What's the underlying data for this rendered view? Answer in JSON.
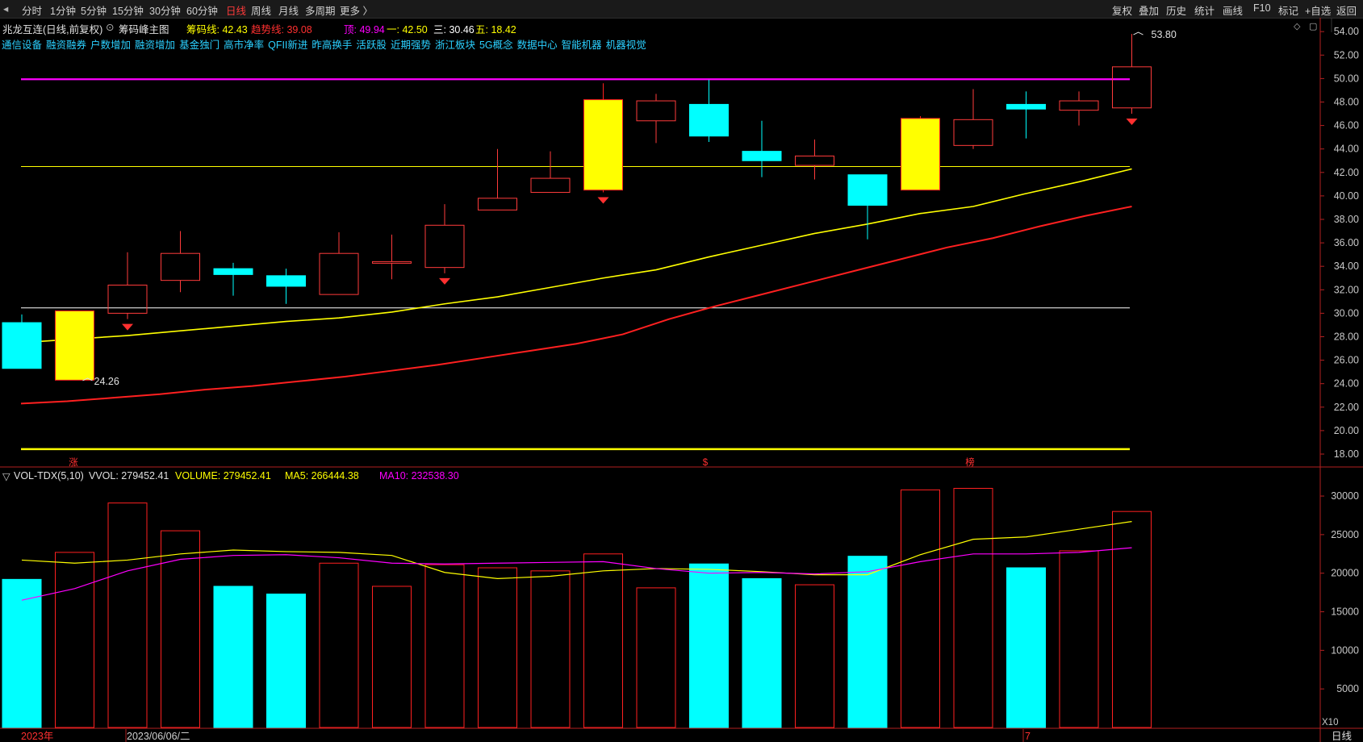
{
  "toolbar": {
    "periods": [
      "分时",
      "1分钟",
      "5分钟",
      "15分钟",
      "30分钟",
      "60分钟",
      "日线",
      "周线",
      "月线",
      "多周期",
      "更多 〉"
    ],
    "active_period": "日线",
    "right_buttons": [
      "复权",
      "叠加",
      "历史",
      "统计",
      "画线",
      "F10",
      "标记",
      "+自选",
      "返回"
    ]
  },
  "header": {
    "stock_title": "兆龙互连(日线,前复权)",
    "indicator_name": "筹码峰主图",
    "chip_line": "筹码线: 42.43",
    "trend_line": "趋势线: 39.08",
    "top_label": "顶: 49.94",
    "one_label": "一: 42.50",
    "three_label": "三: 30.46",
    "five_label": "五: 18.42",
    "window_icons": [
      "◇",
      "▢"
    ]
  },
  "tags": [
    "通信设备",
    "融资融券",
    "户数增加",
    "融资增加",
    "基金独门",
    "高市净率",
    "QFII新进",
    "昨高换手",
    "活跃股",
    "近期强势",
    "浙江板块",
    "5G概念",
    "数据中心",
    "智能机器",
    "机器视觉"
  ],
  "volume_header": {
    "indicator": "VOL-TDX(5,10)",
    "vvol": "VVOL: 279452.41",
    "volume": "VOLUME: 279452.41",
    "ma5": "MA5: 266444.38",
    "ma10": "MA10: 232538.30"
  },
  "annotations": {
    "high_label": "53.80",
    "low_label": "24.26",
    "markers": [
      "涨",
      "$",
      "榜"
    ]
  },
  "bottom": {
    "year_label": "2023年",
    "date_label": "2023/06/06/二",
    "month_label": "7",
    "period_label": "日线",
    "scale_label": "X10"
  },
  "colors": {
    "up": "#ff3b3b",
    "down": "#00ffff",
    "doji_up": "#ffff00",
    "ma_yellow": "#ffff00",
    "ma_red": "#ff2020",
    "magenta": "#ff00ff",
    "background": "#000000"
  },
  "chart_data": [
    {
      "type": "candlestick",
      "title": "兆龙互连(日线,前复权)",
      "y_ticks": [
        18,
        20,
        22,
        24,
        26,
        28,
        30,
        32,
        34,
        36,
        38,
        40,
        42,
        44,
        46,
        48,
        50,
        52,
        54
      ],
      "ylim": [
        17.5,
        55
      ],
      "candles": [
        {
          "o": 29.2,
          "h": 29.9,
          "l": 25.3,
          "c": 25.3,
          "style": "down"
        },
        {
          "o": 24.3,
          "h": 30.2,
          "l": 24.3,
          "c": 30.2,
          "style": "yellow"
        },
        {
          "o": 30.0,
          "h": 35.2,
          "l": 29.5,
          "c": 32.4,
          "style": "up"
        },
        {
          "o": 32.8,
          "h": 37.0,
          "l": 31.8,
          "c": 35.1,
          "style": "up"
        },
        {
          "o": 33.8,
          "h": 34.3,
          "l": 31.5,
          "c": 33.3,
          "style": "down"
        },
        {
          "o": 33.2,
          "h": 33.8,
          "l": 30.8,
          "c": 32.3,
          "style": "down"
        },
        {
          "o": 31.6,
          "h": 36.9,
          "l": 31.6,
          "c": 35.1,
          "style": "up"
        },
        {
          "o": 34.3,
          "h": 36.7,
          "l": 32.9,
          "c": 34.4,
          "style": "up"
        },
        {
          "o": 33.9,
          "h": 39.3,
          "l": 33.4,
          "c": 37.5,
          "style": "up"
        },
        {
          "o": 38.8,
          "h": 44.0,
          "l": 38.8,
          "c": 39.8,
          "style": "up"
        },
        {
          "o": 40.3,
          "h": 43.8,
          "l": 40.3,
          "c": 41.5,
          "style": "up"
        },
        {
          "o": 40.5,
          "h": 49.6,
          "l": 40.3,
          "c": 48.2,
          "style": "yellow"
        },
        {
          "o": 46.4,
          "h": 48.7,
          "l": 44.5,
          "c": 48.1,
          "style": "up"
        },
        {
          "o": 47.8,
          "h": 49.9,
          "l": 44.6,
          "c": 45.1,
          "style": "down"
        },
        {
          "o": 43.8,
          "h": 46.4,
          "l": 41.6,
          "c": 43.0,
          "style": "down"
        },
        {
          "o": 42.6,
          "h": 44.8,
          "l": 41.4,
          "c": 43.4,
          "style": "up"
        },
        {
          "o": 41.8,
          "h": 41.8,
          "l": 36.3,
          "c": 39.2,
          "style": "down"
        },
        {
          "o": 40.5,
          "h": 46.8,
          "l": 40.5,
          "c": 46.6,
          "style": "yellow"
        },
        {
          "o": 44.3,
          "h": 49.1,
          "l": 44.0,
          "c": 46.5,
          "style": "up"
        },
        {
          "o": 47.8,
          "h": 48.9,
          "l": 44.9,
          "c": 47.4,
          "style": "down"
        },
        {
          "o": 47.3,
          "h": 48.9,
          "l": 46.0,
          "c": 48.1,
          "style": "up"
        },
        {
          "o": 47.5,
          "h": 53.8,
          "l": 47.0,
          "c": 51.0,
          "style": "up"
        }
      ],
      "ma_yellow": [
        27.5,
        27.8,
        28.1,
        28.5,
        28.9,
        29.3,
        29.6,
        30.1,
        30.8,
        31.4,
        32.2,
        33.0,
        33.7,
        34.8,
        35.8,
        36.8,
        37.6,
        38.5,
        39.1,
        40.2,
        41.2,
        42.3
      ],
      "ma_red": [
        22.3,
        22.5,
        22.8,
        23.1,
        23.5,
        23.8,
        24.2,
        24.6,
        25.1,
        25.6,
        26.2,
        26.8,
        27.4,
        28.2,
        29.5,
        30.6,
        31.6,
        32.6,
        33.6,
        34.6,
        35.6,
        36.4,
        37.4,
        38.3,
        39.1
      ],
      "hlines": [
        {
          "value": 49.94,
          "color": "#ff00ff",
          "width": 2.2
        },
        {
          "value": 42.5,
          "color": "#ffff00",
          "width": 1
        },
        {
          "value": 30.46,
          "color": "#ffffff",
          "width": 1
        },
        {
          "value": 18.42,
          "color": "#ffff00",
          "width": 2.5
        }
      ],
      "red_markers_at": [
        2,
        8,
        11,
        21
      ]
    },
    {
      "type": "bar",
      "title": "VOL-TDX(5,10)",
      "y_ticks": [
        5000,
        10000,
        15000,
        20000,
        25000,
        30000
      ],
      "ylim": [
        0,
        31500
      ],
      "scale": "X10",
      "volumes": [
        19200,
        22700,
        29100,
        25500,
        18300,
        17300,
        21300,
        18300,
        21100,
        20700,
        20300,
        22500,
        18100,
        21200,
        19300,
        18500,
        22200,
        30800,
        31000,
        20700,
        22900,
        28000
      ],
      "volume_style": [
        "down",
        "up",
        "up",
        "up",
        "down",
        "down",
        "up",
        "up",
        "up",
        "up",
        "up",
        "up",
        "up",
        "down",
        "down",
        "up",
        "down",
        "up",
        "up",
        "down",
        "up",
        "up"
      ],
      "ma5": [
        21700,
        21300,
        21700,
        22500,
        23000,
        22800,
        22700,
        22300,
        20100,
        19300,
        19600,
        20300,
        20600,
        20500,
        20200,
        19800,
        19800,
        22400,
        24400,
        24700,
        25700,
        26700
      ],
      "ma10": [
        16500,
        18000,
        20300,
        21800,
        22300,
        22400,
        22000,
        21300,
        21200,
        21300,
        21400,
        21500,
        20600,
        20000,
        20100,
        19900,
        20200,
        21500,
        22500,
        22500,
        22700,
        23300
      ]
    }
  ]
}
